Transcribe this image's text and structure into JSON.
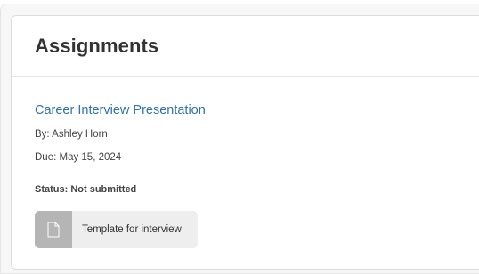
{
  "card": {
    "title": "Assignments"
  },
  "assignment": {
    "title": "Career Interview Presentation",
    "author": "By: Ashley Horn",
    "due": "Due: May 15, 2024",
    "status": "Status: Not submitted",
    "attachment": {
      "label": "Template for interview",
      "icon": "document-icon"
    }
  }
}
